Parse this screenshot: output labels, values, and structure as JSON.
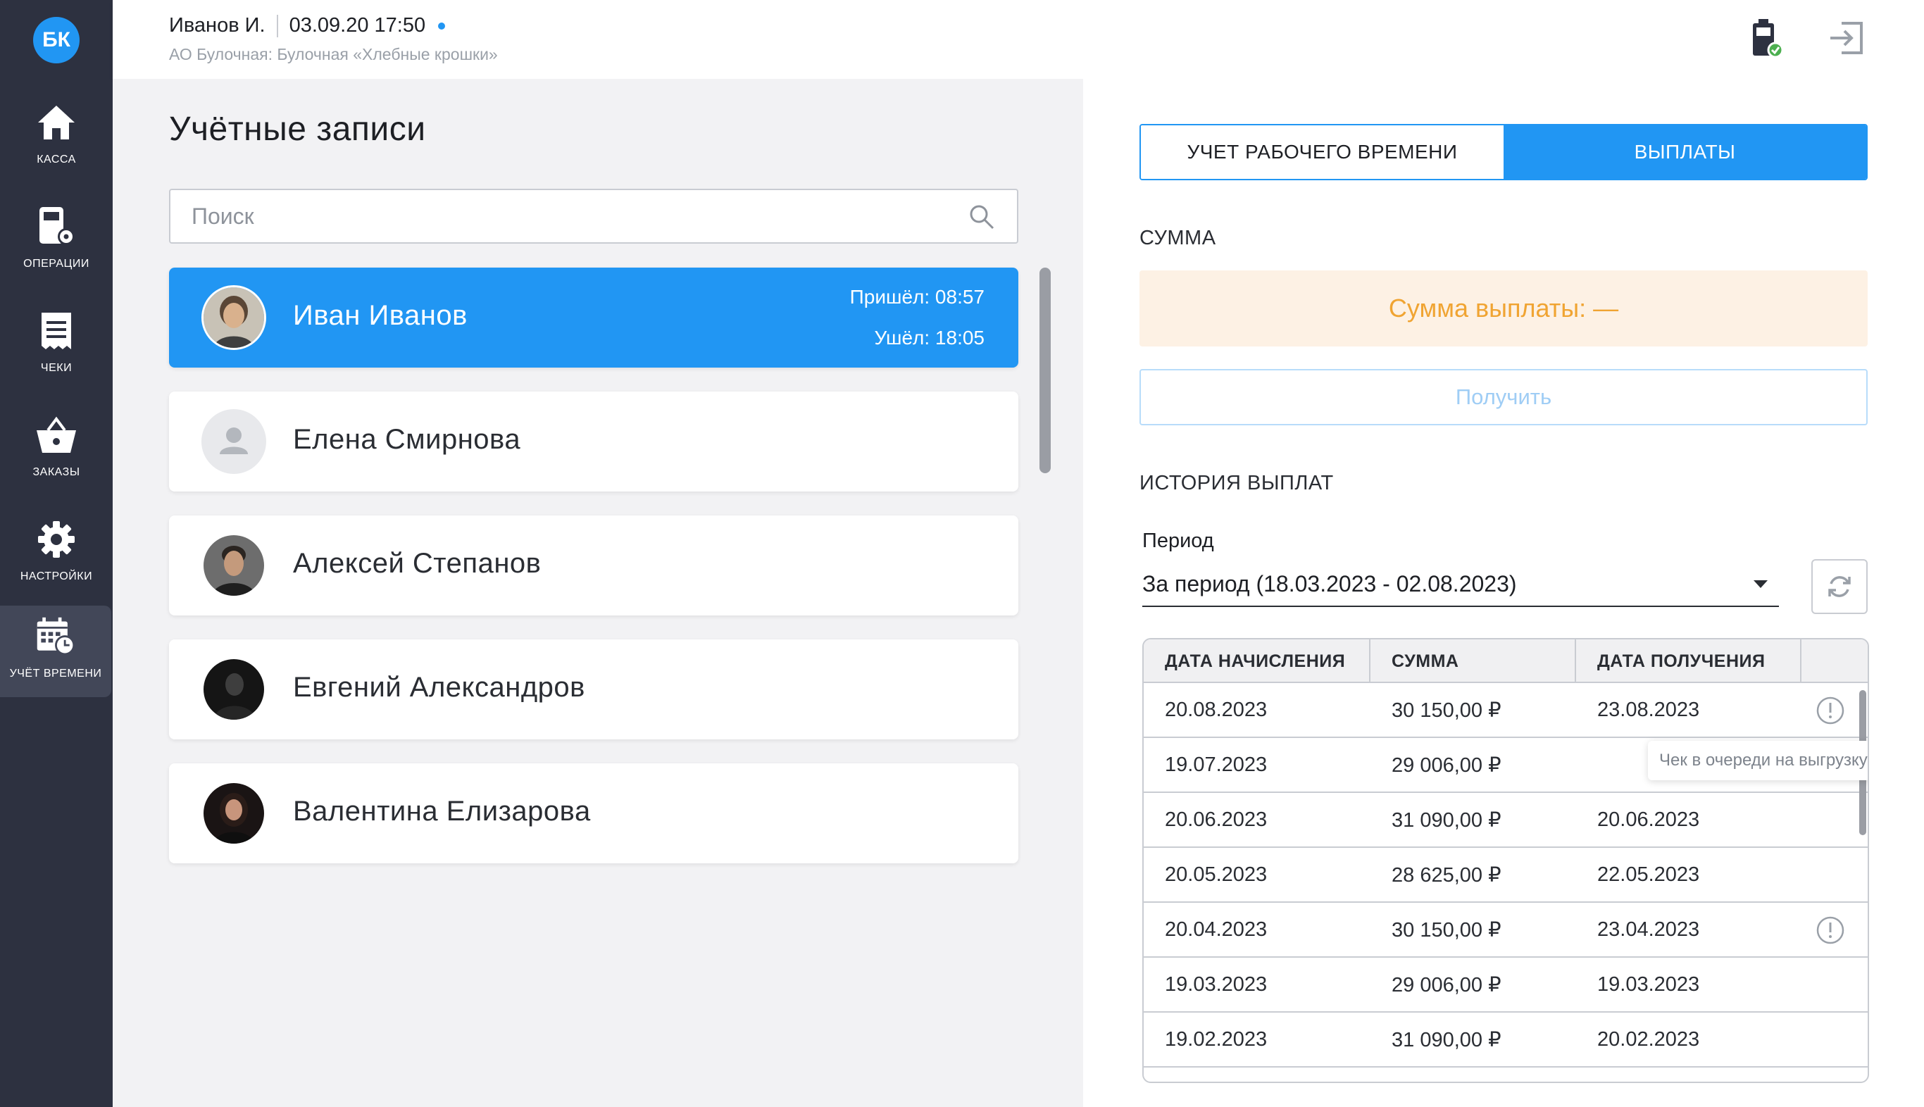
{
  "sidebar": {
    "logo": "БК",
    "items": [
      {
        "label": "КАССА",
        "icon": "home-icon"
      },
      {
        "label": "ОПЕРАЦИИ",
        "icon": "operations-icon"
      },
      {
        "label": "ЧЕКИ",
        "icon": "receipt-icon"
      },
      {
        "label": "ЗАКАЗЫ",
        "icon": "basket-icon"
      },
      {
        "label": "НАСТРОЙКИ",
        "icon": "gear-icon"
      },
      {
        "label": "УЧЁТ ВРЕМЕНИ",
        "icon": "time-tracking-icon",
        "active": true
      }
    ]
  },
  "header": {
    "user": "Иванов И.",
    "datetime": "03.09.20 17:50",
    "org": "АО Булочная: Булочная «Хлебные крошки»",
    "icons": [
      "device-status-icon",
      "logout-icon"
    ]
  },
  "left": {
    "title": "Учётные записи",
    "search_placeholder": "Поиск",
    "employees": [
      {
        "name": "Иван Иванов",
        "arrived": "Пришёл: 08:57",
        "left": "Ушёл: 18:05",
        "active": true
      },
      {
        "name": "Елена Смирнова"
      },
      {
        "name": "Алексей Степанов"
      },
      {
        "name": "Евгений Александров"
      },
      {
        "name": "Валентина Елизарова"
      }
    ]
  },
  "right": {
    "tabs": [
      "УЧЕТ РАБОЧЕГО ВРЕМЕНИ",
      "ВЫПЛАТЫ"
    ],
    "active_tab": "ВЫПЛАТЫ",
    "sum_label": "СУММА",
    "sum_value": "Сумма выплаты: —",
    "get_button": "Получить",
    "history_label": "ИСТОРИЯ ВЫПЛАТ",
    "period_label": "Период",
    "period_value": "За период (18.03.2023 - 02.08.2023)",
    "table": {
      "headers": [
        "ДАТА НАЧИСЛЕНИЯ",
        "СУММА",
        "ДАТА ПОЛУЧЕНИЯ"
      ],
      "rows": [
        {
          "accrual": "20.08.2023",
          "sum": "30 150,00 ₽",
          "received": "23.08.2023",
          "warning": true
        },
        {
          "accrual": "19.07.2023",
          "sum": "29 006,00 ₽",
          "received": "",
          "warning": true
        },
        {
          "accrual": "20.06.2023",
          "sum": "31 090,00 ₽",
          "received": "20.06.2023",
          "warning": false
        },
        {
          "accrual": "20.05.2023",
          "sum": "28 625,00 ₽",
          "received": "22.05.2023",
          "warning": false
        },
        {
          "accrual": "20.04.2023",
          "sum": "30 150,00 ₽",
          "received": "23.04.2023",
          "warning": true
        },
        {
          "accrual": "19.03.2023",
          "sum": "29 006,00 ₽",
          "received": "19.03.2023",
          "warning": false
        },
        {
          "accrual": "19.02.2023",
          "sum": "31 090,00 ₽",
          "received": "20.02.2023",
          "warning": false
        }
      ],
      "tooltip": "Чек в очереди на выгрузку"
    }
  },
  "colors": {
    "accent": "#2196f3",
    "sidebar": "#2d3140",
    "warning_text": "#f0a432",
    "warning_bg": "#fdf1e4"
  }
}
